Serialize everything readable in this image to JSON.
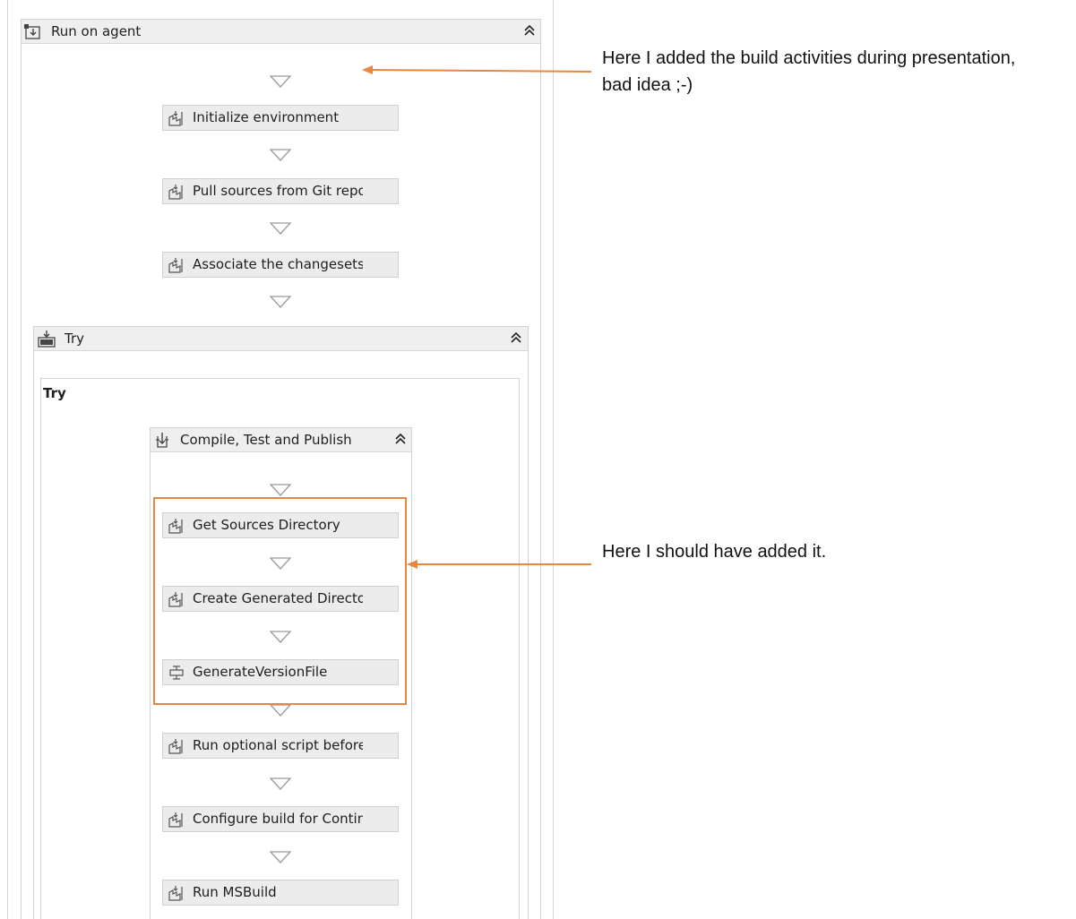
{
  "run_on_agent": {
    "title": "Run on agent"
  },
  "activities_top": [
    {
      "label": "Initialize environment"
    },
    {
      "label": "Pull sources from Git repo"
    },
    {
      "label": "Associate the changesets th"
    }
  ],
  "try_block": {
    "title": "Try",
    "inner_label": "Try"
  },
  "compile_block": {
    "title": "Compile, Test and Publish"
  },
  "activities_compile": [
    {
      "label": "Get Sources Directory"
    },
    {
      "label": "Create Generated Directory"
    },
    {
      "label": "GenerateVersionFile"
    },
    {
      "label": "Run optional script before l"
    },
    {
      "label": "Configure build for Contin"
    },
    {
      "label": "Run MSBuild"
    }
  ],
  "annotations": {
    "note1_line1": "Here I added the build activities during presentation,",
    "note1_line2": "bad idea ;-)",
    "note2": "Here I should have added it."
  },
  "colors": {
    "accent": "#e8873f",
    "header_bg": "#efefef",
    "activity_bg": "#ececec"
  },
  "icons": {
    "run_on_agent": "agent-icon",
    "try": "try-catch-icon",
    "compile": "sequence-icon",
    "activity": "build-activity-icon",
    "generate_version": "invoke-method-icon",
    "collapse": "double-chevron-up-icon",
    "drop": "drop-target-triangle-icon"
  }
}
